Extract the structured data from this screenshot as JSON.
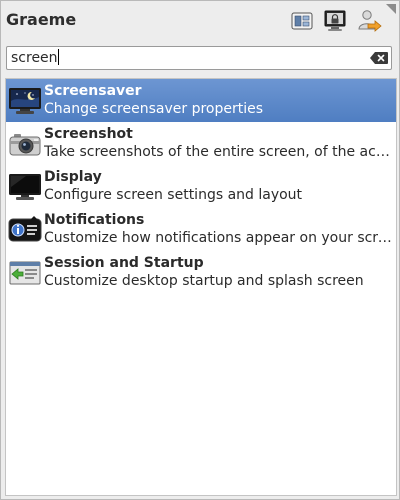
{
  "header": {
    "user_name": "Graeme",
    "buttons": [
      {
        "icon": "switch-user-icon"
      },
      {
        "icon": "lock-screen-icon"
      },
      {
        "icon": "log-out-icon"
      }
    ]
  },
  "search": {
    "value": "screen",
    "clear_icon": "clear-text-icon"
  },
  "results": [
    {
      "title": "Screensaver",
      "description": "Change screensaver properties",
      "icon": "screensaver-icon",
      "selected": true
    },
    {
      "title": "Screenshot",
      "description": "Take screenshots of the entire screen, of the active…",
      "icon": "camera-icon",
      "selected": false
    },
    {
      "title": "Display",
      "description": "Configure screen settings and layout",
      "icon": "display-icon",
      "selected": false
    },
    {
      "title": "Notifications",
      "description": "Customize how notifications appear on your screen",
      "icon": "notifications-icon",
      "selected": false
    },
    {
      "title": "Session and Startup",
      "description": "Customize desktop startup and splash screen",
      "icon": "session-startup-icon",
      "selected": false
    }
  ],
  "colors": {
    "selection": "#5b87c8",
    "panel_background": "#ededed",
    "list_background": "#ffffff"
  }
}
